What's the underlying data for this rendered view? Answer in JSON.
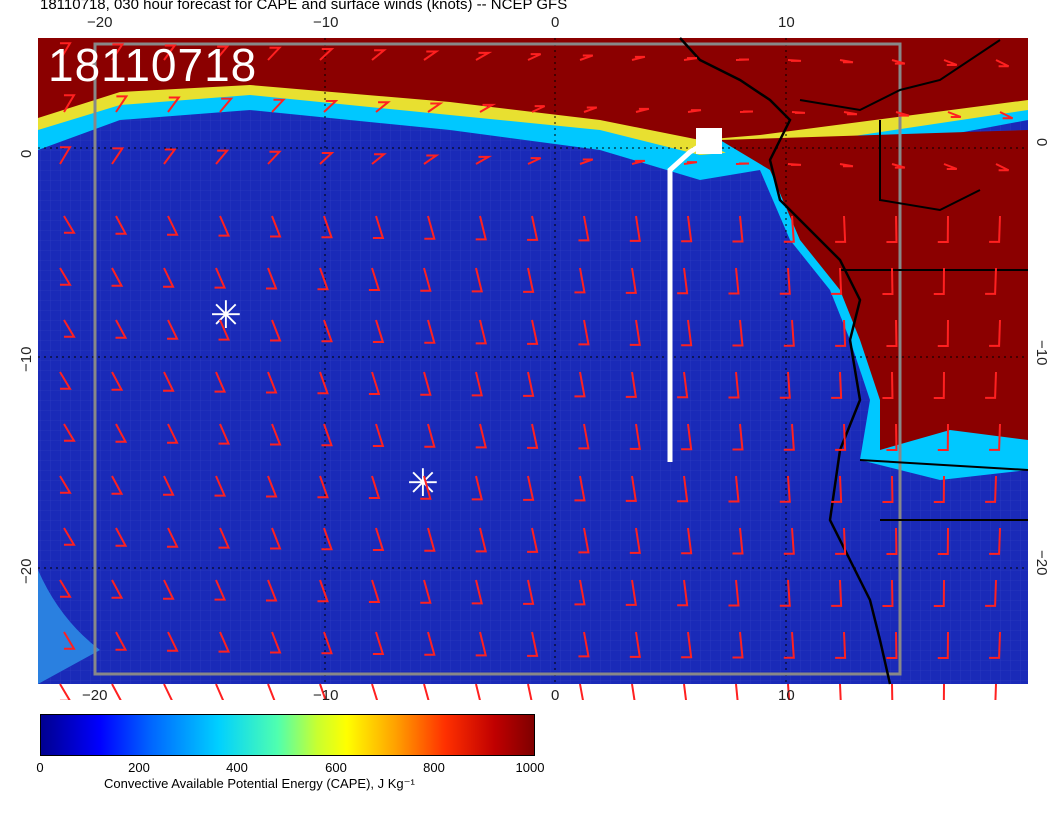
{
  "title": "18110718, 030 hour forecast for CAPE and surface winds (knots) -- NCEP GFS",
  "stamp": "18110718",
  "colors": {
    "ocean_low": "#1a2ab8",
    "cape_high": "#8b0000",
    "wind_barb": "#ff2020",
    "track": "#ffffff",
    "coast": "#000000"
  },
  "axes": {
    "top_ticks": [
      "−20",
      "−10",
      "0",
      "10"
    ],
    "bottom_ticks": [
      "−20",
      "−10",
      "0",
      "10"
    ],
    "left_ticks": [
      "0",
      "−10",
      "−20"
    ],
    "right_ticks": [
      "0",
      "−10",
      "−20"
    ]
  },
  "markers": [
    {
      "name": "cross-marker",
      "symbol": "✳"
    },
    {
      "name": "cross-marker",
      "symbol": "✳"
    }
  ],
  "colorbar": {
    "ticks": [
      "0",
      "200",
      "400",
      "600",
      "800",
      "1000"
    ],
    "label": "Convective Available Potential Energy (CAPE), J Kg⁻¹"
  }
}
